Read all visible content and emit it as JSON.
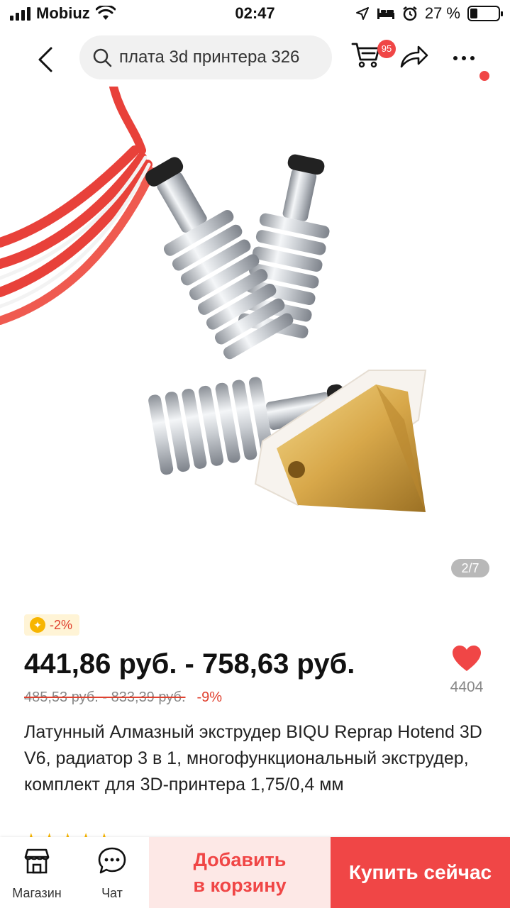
{
  "status_bar": {
    "carrier": "Mobiuz",
    "time": "02:47",
    "battery_text": "27 %",
    "battery_level": 0.27
  },
  "nav": {
    "search_text": "плата 3d принтера 326",
    "cart_count": "95",
    "icons": [
      "back-icon",
      "search-icon",
      "cart-icon",
      "share-icon",
      "more-icon"
    ]
  },
  "product": {
    "image_counter": "2/7",
    "discount_badge": "-2%",
    "price_range": "441,86 руб. - 758,63 руб.",
    "old_price_range": "485,53 руб. - 833,39 руб.",
    "off_percent": "-9%",
    "favorites_count": "4404",
    "title": "Латунный Алмазный экструдер BIQU Reprap Hotend 3D V6, радиатор 3 в 1, многофункциональный экструдер, комплект для 3D-принтера 1,75/0,4 мм"
  },
  "bottom_bar": {
    "store_label": "Магазин",
    "chat_label": "Чат",
    "add_to_cart_line1": "Добавить",
    "add_to_cart_line2": "в корзину",
    "buy_now": "Купить сейчас"
  },
  "colors": {
    "accent": "#f04646",
    "star": "#f7b500"
  }
}
